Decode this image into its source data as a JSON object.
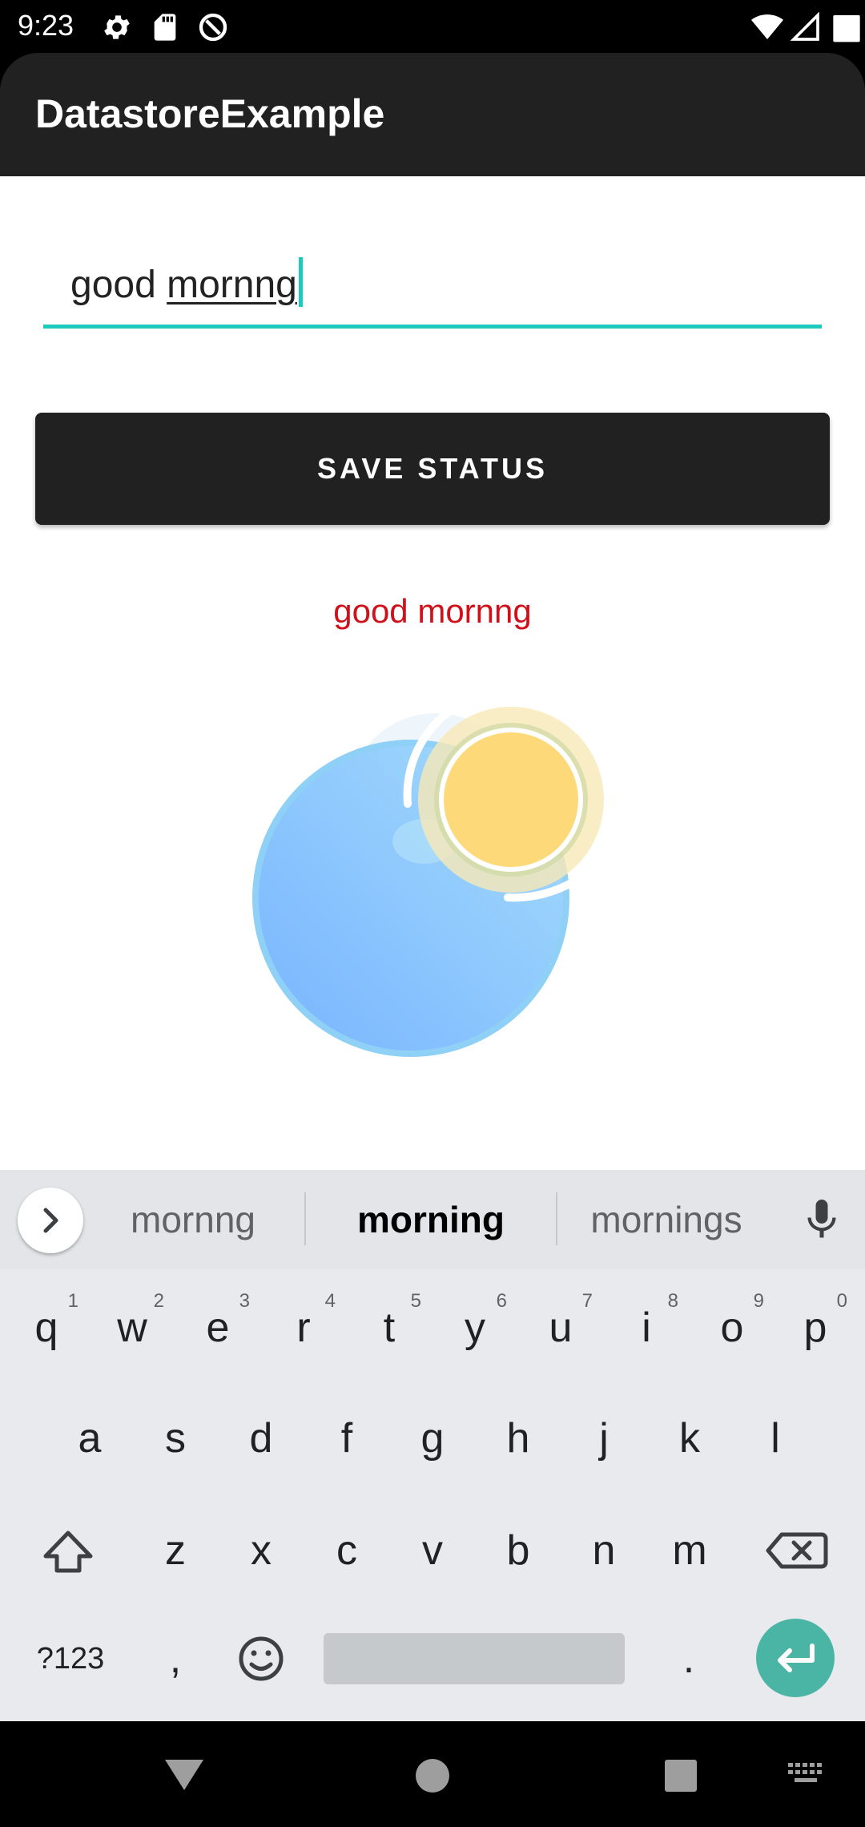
{
  "status_bar": {
    "time": "9:23",
    "icons": [
      "gear-icon",
      "sd-card-icon",
      "do-not-disturb-icon",
      "wifi-icon",
      "cellular-icon",
      "battery-icon"
    ]
  },
  "app_bar": {
    "title": "DatastoreExample"
  },
  "main": {
    "input": {
      "value": "good mornng",
      "committed": "good ",
      "composing": "mornng"
    },
    "save_button_label": "SAVE STATUS",
    "saved_status_text": "good mornng",
    "colors": {
      "accent": "#1ec9bd",
      "saved_text": "#d0101a",
      "button": "#212121"
    }
  },
  "keyboard": {
    "suggestions": [
      "mornng",
      "morning",
      "mornings"
    ],
    "row1": [
      {
        "k": "q",
        "h": "1"
      },
      {
        "k": "w",
        "h": "2"
      },
      {
        "k": "e",
        "h": "3"
      },
      {
        "k": "r",
        "h": "4"
      },
      {
        "k": "t",
        "h": "5"
      },
      {
        "k": "y",
        "h": "6"
      },
      {
        "k": "u",
        "h": "7"
      },
      {
        "k": "i",
        "h": "8"
      },
      {
        "k": "o",
        "h": "9"
      },
      {
        "k": "p",
        "h": "0"
      }
    ],
    "row2": [
      "a",
      "s",
      "d",
      "f",
      "g",
      "h",
      "j",
      "k",
      "l"
    ],
    "row3": [
      "z",
      "x",
      "c",
      "v",
      "b",
      "n",
      "m"
    ],
    "symbols_label": "?123",
    "comma": ",",
    "period": ".",
    "enter_color": "#4bb5a5"
  },
  "nav_bar": {
    "icons": [
      "back-icon",
      "home-icon",
      "recents-icon",
      "keyboard-switch-icon"
    ]
  }
}
